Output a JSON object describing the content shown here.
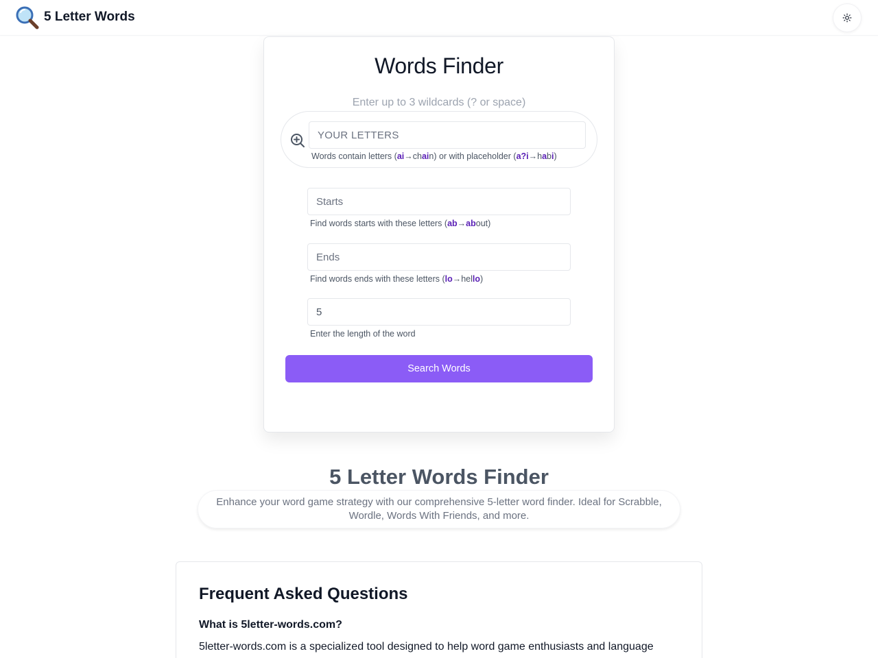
{
  "header": {
    "logo_icon": "magnifier-icon",
    "site_title": "5 Letter Words",
    "theme_toggle_icon": "sun-icon"
  },
  "finder": {
    "title": "Words Finder",
    "wildcard_hint": "Enter up to 3 wildcards (? or space)",
    "letters": {
      "icon": "zoom-in-icon",
      "placeholder": "YOUR LETTERS",
      "value": ""
    },
    "starts": {
      "placeholder": "Starts",
      "value": ""
    },
    "ends": {
      "placeholder": "Ends",
      "value": ""
    },
    "length": {
      "value": "5"
    },
    "help": {
      "contains_1": "Words contain letters (",
      "contains_hl1": "ai",
      "contains_arrow1": "→ch",
      "contains_hl2": "ai",
      "contains_2": "n) or with placeholder (",
      "contains_hl3": "a?i",
      "contains_arrow2": "→h",
      "contains_hl4": "a",
      "contains_3": "b",
      "contains_hl5": "i",
      "contains_4": ")",
      "starts_1": "Find words starts with these letters (",
      "starts_hl1": "ab",
      "starts_arrow": "→",
      "starts_hl2": "ab",
      "starts_2": "out)",
      "ends_1": "Find words ends with these letters (",
      "ends_hl1": "lo",
      "ends_arrow": "→hel",
      "ends_hl2": "lo",
      "ends_2": ")",
      "length": "Enter the length of the word"
    },
    "search_button": "Search Words",
    "accent_color": "#8b5cf6",
    "highlight_color": "#5b21b6"
  },
  "intro": {
    "title": "5 Letter Words Finder",
    "description": "Enhance your word game strategy with our comprehensive 5-letter word finder. Ideal for Scrabble, Wordle, Words With Friends, and more."
  },
  "faq": {
    "title": "Frequent Asked Questions",
    "q1": "What is 5letter-words.com?",
    "a1": "5letter-words.com is a specialized tool designed to help word game enthusiasts and language"
  }
}
